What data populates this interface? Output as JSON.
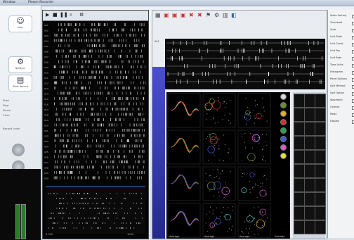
{
  "window": {
    "title": "Window",
    "subtitle": "Plexon Recorder"
  },
  "left_sidebar": {
    "buttons": [
      {
        "icon": "person-icon",
        "label": "User"
      },
      {
        "icon": "network-icon",
        "label": "NetSync"
      },
      {
        "icon": "record-icon",
        "label": "Start Record"
      }
    ],
    "controls": [
      "Start",
      "Stop",
      "Pause",
      "Clear",
      "Record Level"
    ],
    "readouts": [
      "1:52:58 PM",
      "0.00 V MAX"
    ]
  },
  "raster_panel": {
    "toolbar_icons": [
      "play-icon",
      "stop-icon",
      "pause-icon",
      "zoom-icon",
      "settings-icon"
    ],
    "rows": [
      "001",
      "002",
      "003",
      "004",
      "005",
      "006",
      "007",
      "008",
      "009",
      "010",
      "011",
      "012",
      "013",
      "014",
      "015",
      "016",
      "017",
      "018",
      "019",
      "020",
      "021",
      "022",
      "023",
      "024",
      "025",
      "026",
      "027",
      "028",
      "029",
      "030"
    ],
    "bottom_labels": [
      "0.000",
      "1000"
    ]
  },
  "right_panel": {
    "toolbar_icons": [
      "tool-1-icon",
      "tool-2-icon",
      "tool-3-icon",
      "tool-4-icon",
      "tool-5-icon",
      "tool-6-icon",
      "tool-7-icon",
      "tool-8-icon",
      "tool-9-icon",
      "tool-10-icon"
    ],
    "waves_label": "001",
    "units_footer": [
      "Average",
      "Average",
      "Average",
      "Average"
    ],
    "swatch_colors": [
      "#d8d8d8",
      "#6a8f2e",
      "#e0b02a",
      "#d03333",
      "#2da04a",
      "#3a5bd0",
      "#d85ac8",
      "#e0e040"
    ]
  },
  "side_panel": {
    "items": [
      "Spike Sorting",
      "Threshold",
      "Auto",
      "Unit Stats",
      "Unit Count",
      "Unit Pos",
      "Unit Rate",
      "Time Units",
      "Histogram",
      "Panel Options",
      "Sort Method",
      "Sort Option",
      "Waveform",
      "Overlay",
      "Mean",
      "Display"
    ]
  }
}
